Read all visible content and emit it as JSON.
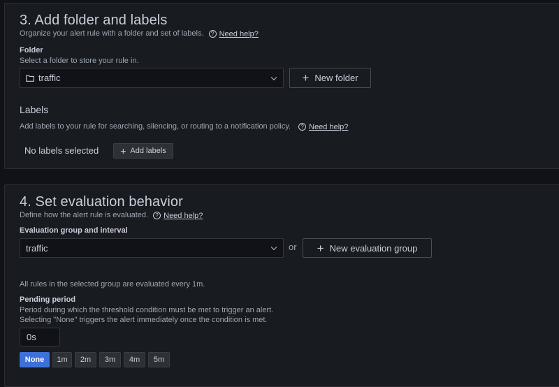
{
  "folder_section": {
    "title": "3. Add folder and labels",
    "description": "Organize your alert rule with a folder and set of labels.",
    "help_text": "Need help?",
    "folder_label": "Folder",
    "folder_description": "Select a folder to store your rule in.",
    "folder_value": "traffic",
    "new_folder_button": "New folder",
    "labels_heading": "Labels",
    "labels_description": "Add labels to your rule for searching, silencing, or routing to a notification policy.",
    "labels_help_text": "Need help?",
    "no_labels_text": "No labels selected",
    "add_labels_button": "Add labels"
  },
  "evaluation_section": {
    "title": "4. Set evaluation behavior",
    "description": "Define how the alert rule is evaluated.",
    "help_text": "Need help?",
    "group_label": "Evaluation group and interval",
    "group_value": "traffic",
    "or_text": "or",
    "new_group_button": "New evaluation group",
    "interval_note": "All rules in the selected group are evaluated every 1m.",
    "pending_label": "Pending period",
    "pending_description_1": "Period during which the threshold condition must be met to trigger an alert.",
    "pending_description_2": "Selecting \"None\" triggers the alert immediately once the condition is met.",
    "pending_value": "0s",
    "pending_options": [
      "None",
      "1m",
      "2m",
      "3m",
      "4m",
      "5m"
    ],
    "selected_option": "None"
  },
  "colors": {
    "background": "#111217",
    "panel": "#181b1f",
    "text": "#ccccdc",
    "secondary_text": "#9fa7b3",
    "primary": "#3d71d9"
  }
}
